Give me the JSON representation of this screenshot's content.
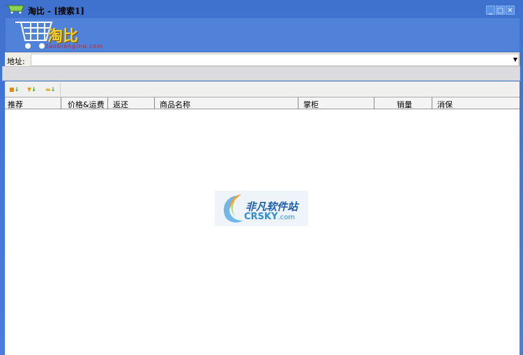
{
  "window": {
    "title": "淘比 - [搜索1]",
    "buttons": [
      "minimize",
      "maximize",
      "close"
    ]
  },
  "banner": {
    "logo_text": "淘比",
    "logo_sub": "taobiengine.com"
  },
  "address": {
    "label": "地址:",
    "value": ""
  },
  "columns": [
    "推荐",
    "价格&运费",
    "返还",
    "商品名称",
    "掌柜",
    "销量",
    "消保"
  ],
  "watermark": {
    "cn": "非凡软件站",
    "en": "CRSKY",
    "en_suffix": ".com"
  }
}
